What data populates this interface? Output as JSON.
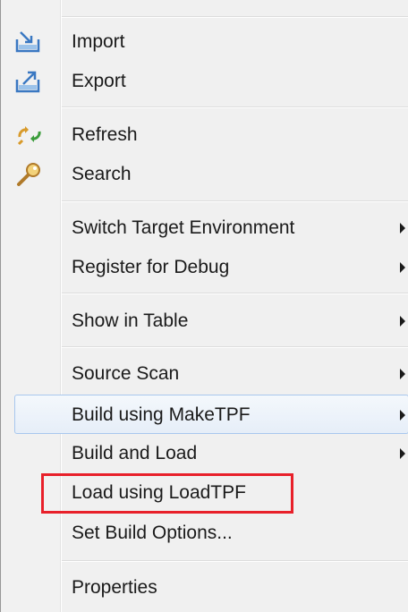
{
  "menu": {
    "items": [
      {
        "label": "Import",
        "icon": "import-icon"
      },
      {
        "label": "Export",
        "icon": "export-icon"
      },
      {
        "label": "Refresh",
        "icon": "refresh-icon"
      },
      {
        "label": "Search",
        "icon": "search-icon"
      },
      {
        "label": "Switch Target Environment",
        "submenu": true
      },
      {
        "label": "Register for Debug",
        "submenu": true
      },
      {
        "label": "Show in Table",
        "submenu": true
      },
      {
        "label": "Source Scan",
        "submenu": true
      },
      {
        "label": "Build using MakeTPF",
        "submenu": true,
        "hovered": true
      },
      {
        "label": "Build and Load",
        "submenu": true
      },
      {
        "label": "Load using LoadTPF",
        "annotated": true
      },
      {
        "label": "Set Build Options..."
      },
      {
        "label": "Properties"
      }
    ]
  },
  "colors": {
    "annotation_border": "#e8202a",
    "hover_border": "#a8c7ee",
    "menu_background": "#f0f0f0"
  }
}
